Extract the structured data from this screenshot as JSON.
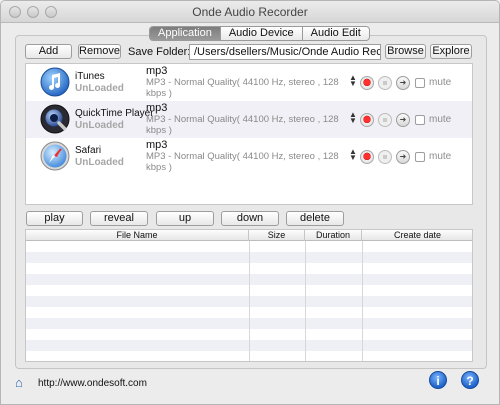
{
  "window": {
    "title": "Onde Audio Recorder"
  },
  "tabs": [
    {
      "label": "Application",
      "active": true
    },
    {
      "label": "Audio Device",
      "active": false
    },
    {
      "label": "Audio Edit",
      "active": false
    }
  ],
  "toolbar": {
    "add_label": "Add",
    "remove_label": "Remove",
    "save_folder_label": "Save Folder:",
    "save_folder_value": "/Users/dsellers/Music/Onde Audio Recorde",
    "browse_label": "Browse",
    "explore_label": "Explore"
  },
  "apps": [
    {
      "name": "iTunes",
      "status": "UnLoaded",
      "icon": "itunes-icon",
      "format": "mp3",
      "quality": "MP3 - Normal Quality( 44100 Hz, stereo , 128 kbps )",
      "mute_label": "mute"
    },
    {
      "name": "QuickTime Player",
      "status": "UnLoaded",
      "icon": "quicktime-icon",
      "format": "mp3",
      "quality": "MP3 - Normal Quality( 44100 Hz, stereo , 128 kbps )",
      "mute_label": "mute"
    },
    {
      "name": "Safari",
      "status": "UnLoaded",
      "icon": "safari-icon",
      "format": "mp3",
      "quality": "MP3 - Normal Quality( 44100 Hz, stereo , 128 kbps )",
      "mute_label": "mute"
    }
  ],
  "actions": {
    "play_label": "play",
    "reveal_label": "reveal",
    "up_label": "up",
    "down_label": "down",
    "delete_label": "delete"
  },
  "file_table": {
    "columns": [
      "File Name",
      "Size",
      "Duration",
      "Create date"
    ],
    "rows": []
  },
  "footer": {
    "url": "http://www.ondesoft.com",
    "info_icon": "info-icon",
    "help_icon": "help-icon",
    "home_icon": "home-icon"
  },
  "colors": {
    "record_red": "#e01010",
    "tab_active": "#8a8a8a",
    "link_blue": "#2e67b3"
  }
}
